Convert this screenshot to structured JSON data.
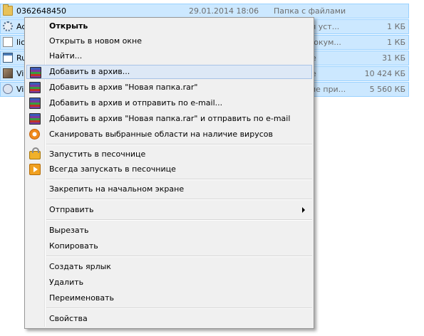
{
  "files": [
    {
      "name": "0362648450",
      "date": "29.01.2014 18:06",
      "type": "Папка с файлами",
      "size": "",
      "icon": "folder-icon"
    },
    {
      "name": "Ac",
      "date": "",
      "type": "для уст...",
      "size": "1 КБ",
      "icon": "gear-file-icon"
    },
    {
      "name": "lic",
      "date": "",
      "type": "й докум...",
      "size": "1 КБ",
      "icon": "document-icon"
    },
    {
      "name": "Ru",
      "date": "",
      "type": "е",
      "size": "31 КБ",
      "icon": "application-icon"
    },
    {
      "name": "Vi",
      "date": "",
      "type": "е",
      "size": "10 424 КБ",
      "icon": "image-file-icon"
    },
    {
      "name": "Vi",
      "date": "",
      "type": "ение при...",
      "size": "5 560 КБ",
      "icon": "setup-icon"
    }
  ],
  "context_menu": {
    "items": [
      {
        "label": "Открыть",
        "icon": ""
      },
      {
        "label": "Открыть в новом окне",
        "icon": ""
      },
      {
        "label": "Найти...",
        "icon": ""
      },
      {
        "label": "Добавить в архив...",
        "icon": "winrar-icon"
      },
      {
        "label": "Добавить в архив \"Новая папка.rar\"",
        "icon": "winrar-icon"
      },
      {
        "label": "Добавить в архив и отправить по e-mail...",
        "icon": "winrar-icon"
      },
      {
        "label": "Добавить в архив \"Новая папка.rar\" и отправить по e-mail",
        "icon": "winrar-icon"
      },
      {
        "label": "Сканировать выбранные области на наличие вирусов",
        "icon": "antivirus-icon"
      },
      {
        "label": "Запустить в песочнице",
        "icon": "sandbox-lock-icon"
      },
      {
        "label": "Всегда запускать в песочнице",
        "icon": "sandbox-play-icon"
      },
      {
        "label": "Закрепить на начальном экране",
        "icon": ""
      },
      {
        "label": "Отправить",
        "icon": "chevron-right-icon"
      },
      {
        "label": "Вырезать",
        "icon": ""
      },
      {
        "label": "Копировать",
        "icon": ""
      },
      {
        "label": "Создать ярлык",
        "icon": ""
      },
      {
        "label": "Удалить",
        "icon": ""
      },
      {
        "label": "Переименовать",
        "icon": ""
      },
      {
        "label": "Свойства",
        "icon": ""
      }
    ]
  },
  "colors": {
    "selection_bg": "#cce8ff",
    "selection_border": "#99d1ff",
    "menu_bg": "#f0f0f0",
    "menu_hover": "#dde8f6"
  }
}
